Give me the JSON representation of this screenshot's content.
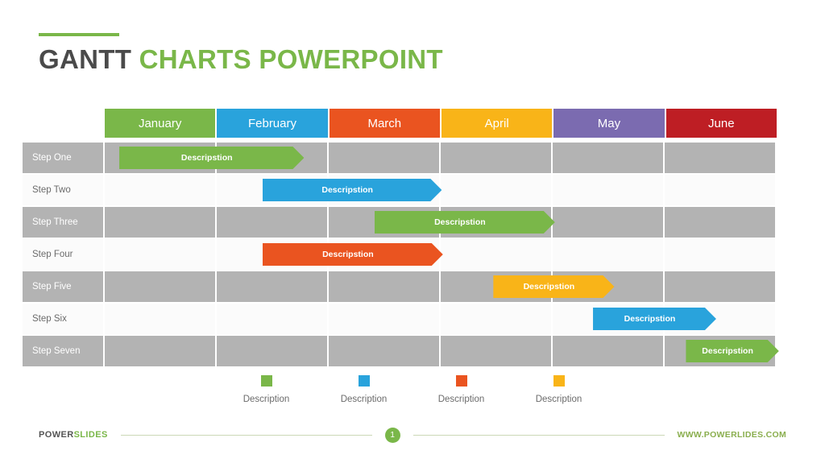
{
  "title": {
    "part_dark": "GANTT",
    "part_green": " CHARTS POWERPOINT",
    "accent_color": "#7AB749"
  },
  "chart_data": {
    "type": "bar",
    "subtype": "gantt",
    "title": "GANTT CHARTS POWERPOINT",
    "xlabel": "",
    "ylabel": "",
    "categories": [
      "January",
      "February",
      "March",
      "April",
      "May",
      "June"
    ],
    "category_colors": [
      "#7AB749",
      "#29A3DC",
      "#EA5420",
      "#F9B418",
      "#7B6BB0",
      "#BE1E24"
    ],
    "rows": [
      "Step One",
      "Step Two",
      "Step Three",
      "Step Four",
      "Step Five",
      "Step Six",
      "Step Seven"
    ],
    "tasks": [
      {
        "row": "Step One",
        "label": "Descripstion",
        "color": "#7AB749",
        "start_month": 0.13,
        "end_month": 1.78
      },
      {
        "row": "Step Two",
        "label": "Descripstion",
        "color": "#29A3DC",
        "start_month": 1.41,
        "end_month": 3.01
      },
      {
        "row": "Step Three",
        "label": "Descripstion",
        "color": "#7AB749",
        "start_month": 2.41,
        "end_month": 4.02
      },
      {
        "row": "Step Four",
        "label": "Descripstion",
        "color": "#EA5420",
        "start_month": 1.41,
        "end_month": 3.02
      },
      {
        "row": "Step Five",
        "label": "Descripstion",
        "color": "#F9B418",
        "start_month": 3.47,
        "end_month": 4.55
      },
      {
        "row": "Step Six",
        "label": "Descripstion",
        "color": "#29A3DC",
        "start_month": 4.36,
        "end_month": 5.46
      },
      {
        "row": "Step Seven",
        "label": "Descripstion",
        "color": "#7AB749",
        "start_month": 5.19,
        "end_month": 6.02
      }
    ],
    "legend_position": "bottom",
    "legend": [
      {
        "label": "Description",
        "color": "#7AB749"
      },
      {
        "label": "Description",
        "color": "#29A3DC"
      },
      {
        "label": "Description",
        "color": "#EA5420"
      },
      {
        "label": "Description",
        "color": "#F9B418"
      }
    ],
    "grid": true,
    "row_shading": [
      "shaded",
      "plain",
      "shaded",
      "plain",
      "shaded",
      "plain",
      "shaded"
    ]
  },
  "months": [
    {
      "label": "January",
      "color": "#7AB749"
    },
    {
      "label": "February",
      "color": "#29A3DC"
    },
    {
      "label": "March",
      "color": "#EA5420"
    },
    {
      "label": "April",
      "color": "#F9B418"
    },
    {
      "label": "May",
      "color": "#7B6BB0"
    },
    {
      "label": "June",
      "color": "#BE1E24"
    }
  ],
  "rows": [
    {
      "label": "Step One"
    },
    {
      "label": "Step Two"
    },
    {
      "label": "Step Three"
    },
    {
      "label": "Step Four"
    },
    {
      "label": "Step Five"
    },
    {
      "label": "Step Six"
    },
    {
      "label": "Step Seven"
    }
  ],
  "bars": [
    {
      "label": "Descripstion"
    },
    {
      "label": "Descripstion"
    },
    {
      "label": "Descripstion"
    },
    {
      "label": "Descripstion"
    },
    {
      "label": "Descripstion"
    },
    {
      "label": "Descripstion"
    },
    {
      "label": "Descripstion"
    }
  ],
  "legend": [
    {
      "label": "Description"
    },
    {
      "label": "Description"
    },
    {
      "label": "Description"
    },
    {
      "label": "Description"
    }
  ],
  "footer": {
    "brand_dark": "POWER",
    "brand_green": "SLIDES",
    "page_number": "1",
    "url": "WWW.POWERLIDES.COM"
  }
}
